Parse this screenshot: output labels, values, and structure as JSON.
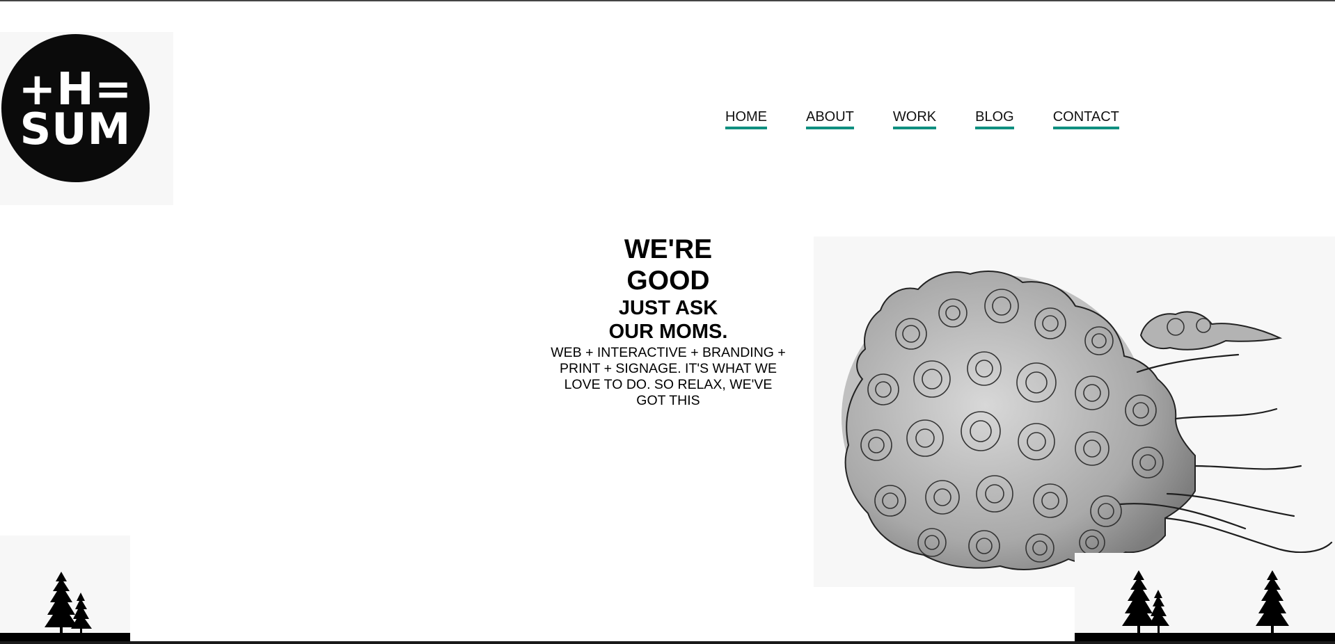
{
  "brand": {
    "logo_line_1": "+H=",
    "logo_line_2": "SUM"
  },
  "nav": {
    "items": [
      {
        "label": "HOME"
      },
      {
        "label": "ABOUT"
      },
      {
        "label": "WORK"
      },
      {
        "label": "BLOG"
      },
      {
        "label": "CONTACT"
      }
    ],
    "underline_color": "#0f8f7f"
  },
  "hero": {
    "line_1": "WE'RE",
    "line_2": "GOOD",
    "line_3": "JUST ASK",
    "line_4": "OUR MOMS.",
    "body": "WEB + INTERACTIVE + BRANDING + PRINT + SIGNAGE. IT'S WHAT WE LOVE TO DO. SO RELAX, WE'VE GOT THIS"
  },
  "images": {
    "illustration": "swirling-cloud-drawing",
    "footer_decoration": "pine-tree-silhouettes"
  }
}
